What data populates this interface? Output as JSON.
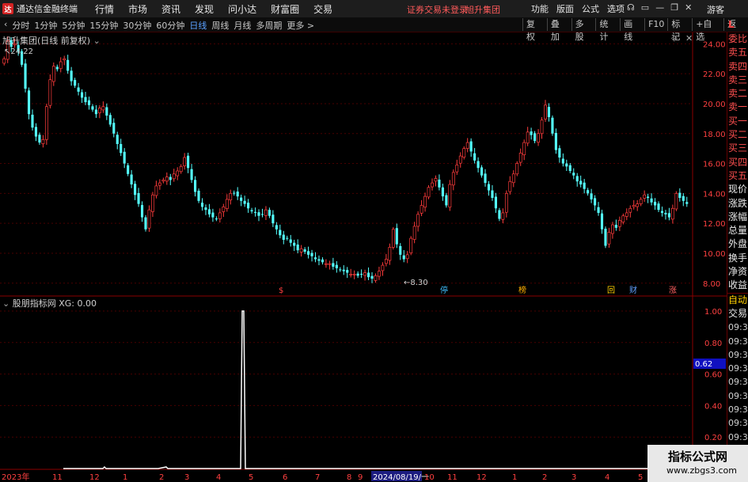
{
  "titlebar": {
    "app_title": "通达信金融终端",
    "menu": [
      "行情",
      "市场",
      "资讯",
      "发现",
      "问小达",
      "财富圈",
      "交易"
    ],
    "login_status": "证券交易未登录",
    "stock_name": "旭升集团",
    "right_menu": [
      "功能",
      "版面",
      "公式",
      "选项"
    ],
    "guest": "游客"
  },
  "toolbar": {
    "periods": [
      "分时",
      "1分钟",
      "5分钟",
      "15分钟",
      "30分钟",
      "60分钟",
      "日线",
      "周线",
      "月线",
      "多周期",
      "更多 >"
    ],
    "active_period": "日线",
    "tools": [
      "复权",
      "叠加",
      "多股",
      "统计",
      "画线",
      "F10",
      "标记",
      "+自选",
      "返回"
    ],
    "level_badge": "L"
  },
  "upper_panel": {
    "legend": "旭升集团(日线 前复权)",
    "y_ticks": [
      "24.00",
      "22.00",
      "20.00",
      "18.00",
      "16.00",
      "14.00",
      "12.00",
      "10.00",
      "8.00"
    ],
    "high_label": "24.22",
    "low_label": "8.30",
    "markers": [
      {
        "text": "$",
        "color": "#ff4040"
      },
      {
        "text": "停",
        "color": "#40c0ff"
      },
      {
        "text": "榜",
        "color": "#ffb000"
      },
      {
        "text": "回",
        "color": "#ffd000"
      },
      {
        "text": "财",
        "color": "#60a0ff"
      },
      {
        "text": "涨",
        "color": "#ff6060"
      }
    ]
  },
  "lower_panel": {
    "legend": "股朋指标网 XG: 0.00",
    "y_ticks": [
      "1.00",
      "0.80",
      "0.60",
      "0.40",
      "0.20"
    ],
    "current_value": "0.62"
  },
  "time_axis": {
    "labels": [
      "2023年",
      "11",
      "12",
      "1",
      "2",
      "3",
      "4",
      "5",
      "6",
      "7",
      "8",
      "9",
      "2024/08/19/一",
      "10",
      "11",
      "12",
      "1",
      "2",
      "3",
      "4",
      "5"
    ],
    "highlight": "2024/08/19/一"
  },
  "sidebar": {
    "items": [
      "委比",
      "卖五",
      "卖四",
      "卖三",
      "卖二",
      "卖一",
      "买一",
      "买二",
      "买三",
      "买四",
      "买五",
      "现价",
      "涨跌",
      "涨幅",
      "总量",
      "外盘",
      "换手",
      "净资",
      "收益"
    ],
    "trade_labels": [
      "自动",
      "交易"
    ],
    "times": [
      "09:34",
      "09:34",
      "09:34",
      "09:34",
      "09:34",
      "09:34",
      "09:34",
      "09:35",
      "09:35"
    ]
  },
  "watermark": {
    "main": "指标公式网",
    "url": "www.zbgs3.com"
  },
  "colors": {
    "up": "#ff3c3c",
    "down": "#54ffff",
    "axis": "#8b0000",
    "grid": "#4a0000",
    "indicator": "#ffffff"
  },
  "chart_data": {
    "type": "candlestick",
    "title": "旭升集团(日线 前复权)",
    "ylim": [
      7.3,
      24.6
    ],
    "close_series": [
      23.0,
      24.2,
      23.8,
      24.0,
      23.5,
      22.6,
      21.0,
      19.3,
      18.4,
      17.8,
      17.4,
      17.6,
      19.8,
      21.6,
      22.5,
      22.3,
      22.8,
      23.0,
      22.2,
      21.5,
      21.2,
      20.8,
      20.4,
      20.1,
      19.9,
      19.6,
      19.3,
      19.7,
      19.8,
      19.2,
      18.6,
      18.0,
      17.3,
      16.7,
      16.0,
      15.3,
      14.6,
      13.9,
      13.3,
      12.4,
      11.6,
      12.9,
      13.9,
      14.5,
      14.7,
      14.9,
      15.1,
      14.9,
      15.3,
      15.5,
      15.8,
      16.4,
      15.7,
      14.9,
      14.1,
      13.5,
      13.1,
      12.9,
      12.6,
      12.4,
      12.3,
      12.7,
      13.1,
      13.6,
      14.0,
      14.0,
      13.8,
      13.5,
      13.3,
      13.0,
      12.8,
      12.7,
      12.5,
      12.6,
      12.9,
      12.5,
      12.0,
      11.6,
      11.2,
      10.9,
      11.0,
      10.7,
      10.5,
      10.2,
      10.3,
      10.1,
      9.9,
      9.8,
      9.6,
      9.5,
      9.4,
      9.3,
      9.3,
      9.1,
      9.0,
      8.9,
      8.8,
      8.7,
      8.6,
      8.6,
      8.5,
      8.6,
      8.7,
      8.4,
      8.3,
      8.5,
      8.8,
      9.2,
      9.6,
      10.4,
      11.6,
      10.6,
      9.9,
      9.6,
      9.9,
      11.0,
      11.8,
      12.6,
      13.2,
      13.8,
      14.4,
      14.7,
      15.0,
      14.4,
      13.8,
      13.2,
      14.6,
      15.4,
      15.9,
      16.5,
      17.0,
      17.4,
      16.8,
      16.2,
      15.7,
      15.2,
      14.7,
      14.2,
      13.7,
      13.0,
      12.3,
      12.7,
      14.0,
      14.8,
      15.3,
      16.0,
      16.7,
      17.4,
      18.1,
      17.9,
      17.5,
      18.0,
      18.9,
      19.9,
      19.1,
      18.0,
      16.9,
      16.4,
      16.0,
      15.8,
      15.5,
      15.2,
      14.8,
      14.6,
      14.3,
      14.0,
      13.6,
      13.2,
      12.7,
      11.6,
      10.5,
      11.4,
      11.9,
      11.7,
      12.2,
      12.5,
      12.7,
      13.0,
      13.2,
      13.3,
      13.6,
      13.9,
      13.7,
      13.4,
      13.2,
      12.9,
      12.7,
      12.6,
      12.4,
      13.0,
      14.0,
      13.7,
      13.5,
      13.3
    ]
  }
}
